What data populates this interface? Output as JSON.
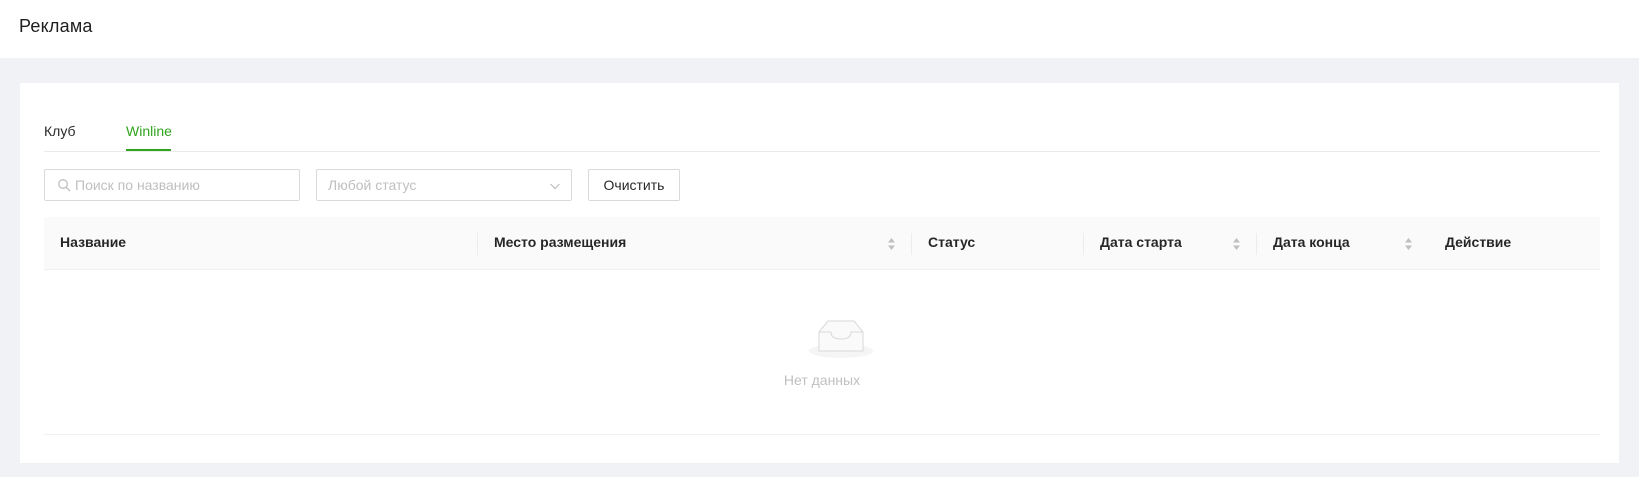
{
  "page": {
    "title": "Реклама"
  },
  "tabs": [
    {
      "label": "Клуб",
      "active": false
    },
    {
      "label": "Winline",
      "active": true
    }
  ],
  "filters": {
    "search_placeholder": "Поиск по названию",
    "status_placeholder": "Любой статус",
    "clear_label": "Очистить"
  },
  "table": {
    "columns": [
      {
        "label": "Название",
        "sortable": false
      },
      {
        "label": "Место размещения",
        "sortable": true
      },
      {
        "label": "Статус",
        "sortable": false
      },
      {
        "label": "Дата старта",
        "sortable": true
      },
      {
        "label": "Дата конца",
        "sortable": true
      },
      {
        "label": "Действие",
        "sortable": false
      }
    ],
    "rows": [],
    "empty_text": "Нет данных"
  },
  "colors": {
    "accent": "#2ea41c",
    "background": "#f0f2f5"
  },
  "icons": [
    "search-icon",
    "chevron-down-icon",
    "sort-icon",
    "empty-inbox-icon"
  ]
}
